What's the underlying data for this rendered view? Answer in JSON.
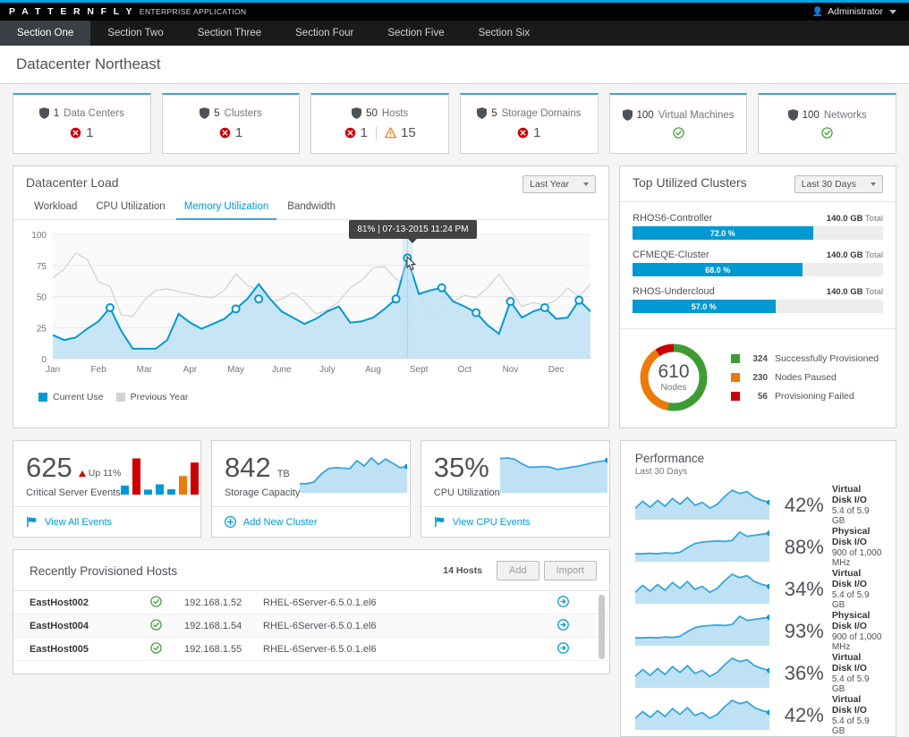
{
  "masthead": {
    "brand": "P A T T E R N F L Y",
    "brand_sub": "ENTERPRISE APPLICATION",
    "user": "Administrator",
    "user_icon": "user-icon",
    "caret_icon": "chevron-down-icon"
  },
  "nav": {
    "items": [
      {
        "label": "Section One",
        "active": true
      },
      {
        "label": "Section Two",
        "active": false
      },
      {
        "label": "Section Three",
        "active": false
      },
      {
        "label": "Section Four",
        "active": false
      },
      {
        "label": "Section Five",
        "active": false
      },
      {
        "label": "Section Six",
        "active": false
      }
    ]
  },
  "page": {
    "title": "Datacenter Northeast"
  },
  "aggregate_cards": [
    {
      "count": "1",
      "label": "Data Centers",
      "icon": "shield-icon",
      "stats": [
        {
          "icon": "error-circle-icon",
          "value": "1",
          "color": "#cc0000"
        }
      ]
    },
    {
      "count": "5",
      "label": "Clusters",
      "icon": "shield-icon",
      "stats": [
        {
          "icon": "error-circle-icon",
          "value": "1",
          "color": "#cc0000"
        }
      ]
    },
    {
      "count": "50",
      "label": "Hosts",
      "icon": "shield-icon",
      "stats": [
        {
          "icon": "error-circle-icon",
          "value": "1",
          "color": "#cc0000"
        },
        {
          "icon": "warning-triangle-icon",
          "value": "15",
          "color": "#ec7a08"
        }
      ]
    },
    {
      "count": "5",
      "label": "Storage Domains",
      "icon": "shield-icon",
      "stats": [
        {
          "icon": "error-circle-icon",
          "value": "1",
          "color": "#cc0000"
        }
      ]
    },
    {
      "count": "100",
      "label": "Virtual Machines",
      "icon": "shield-icon",
      "stats": [
        {
          "icon": "ok-circle-icon",
          "value": "",
          "color": "#3f9c35"
        }
      ]
    },
    {
      "count": "100",
      "label": "Networks",
      "icon": "shield-icon",
      "stats": [
        {
          "icon": "ok-circle-icon",
          "value": "",
          "color": "#3f9c35"
        }
      ]
    }
  ],
  "datacenter_load": {
    "title": "Datacenter Load",
    "range_selector": "Last Year",
    "tabs": [
      {
        "label": "Workload",
        "active": false
      },
      {
        "label": "CPU Utilization",
        "active": false
      },
      {
        "label": "Memory Utilization",
        "active": true
      },
      {
        "label": "Bandwidth",
        "active": false
      }
    ],
    "tooltip": "81% | 07-13-2015 11:24 PM",
    "legend": [
      {
        "label": "Current Use",
        "color": "#0099d3"
      },
      {
        "label": "Previous Year",
        "color": "#d1d1d1"
      }
    ]
  },
  "chart_data": {
    "type": "area",
    "title": "Datacenter Load — Memory Utilization",
    "xlabel": "",
    "ylabel": "",
    "ylim": [
      0,
      100
    ],
    "yticks": [
      0,
      25,
      50,
      75,
      100
    ],
    "grid": true,
    "legend_position": "bottom-left",
    "tick_labels": [
      "Jan",
      "Feb",
      "Mar",
      "Apr",
      "May",
      "June",
      "July",
      "Aug",
      "Sept",
      "Oct",
      "Nov",
      "Dec"
    ],
    "x": [
      0,
      1,
      2,
      3,
      4,
      5,
      6,
      7,
      8,
      9,
      10,
      11,
      12,
      13,
      14,
      15,
      16,
      17,
      18,
      19,
      20,
      21,
      22,
      23,
      24,
      25,
      26,
      27,
      28,
      29,
      30,
      31,
      32,
      33,
      34,
      35,
      36,
      37,
      38,
      39,
      40,
      41,
      42,
      43,
      44,
      45,
      46,
      47
    ],
    "series": [
      {
        "name": "Current Use",
        "color": "#0099d3",
        "values": [
          19,
          15,
          17,
          24,
          30,
          41,
          22,
          8,
          8,
          8,
          15,
          36,
          29,
          24,
          28,
          32,
          40,
          48,
          60,
          48,
          38,
          33,
          28,
          32,
          38,
          42,
          29,
          30,
          33,
          40,
          48,
          81,
          52,
          55,
          57,
          46,
          42,
          37,
          27,
          20,
          46,
          33,
          38,
          41,
          32,
          33,
          47,
          38
        ],
        "markers": [
          {
            "x": 5,
            "y": 41
          },
          {
            "x": 16,
            "y": 40
          },
          {
            "x": 18,
            "y": 48
          },
          {
            "x": 30,
            "y": 48
          },
          {
            "x": 31,
            "y": 81
          },
          {
            "x": 34,
            "y": 57
          },
          {
            "x": 37,
            "y": 37
          },
          {
            "x": 40,
            "y": 46
          },
          {
            "x": 43,
            "y": 41
          },
          {
            "x": 46,
            "y": 47
          }
        ]
      },
      {
        "name": "Previous Year",
        "color": "#d1d1d1",
        "values": [
          65,
          72,
          85,
          80,
          62,
          58,
          35,
          34,
          47,
          55,
          56,
          54,
          52,
          50,
          49,
          55,
          68,
          59,
          55,
          46,
          48,
          53,
          46,
          36,
          39,
          46,
          57,
          63,
          73,
          74,
          64,
          59,
          53,
          35,
          36,
          46,
          51,
          49,
          57,
          68,
          55,
          42,
          45,
          43,
          47,
          57,
          50,
          60
        ]
      }
    ]
  },
  "top_clusters": {
    "title": "Top Utilized Clusters",
    "range_selector": "Last 30 Days",
    "items": [
      {
        "name": "RHOS6-Controller",
        "percent": 72.0,
        "percent_label": "72.0 %",
        "total": "140.0 GB",
        "total_suffix": "Total"
      },
      {
        "name": "CFMEQE-Cluster",
        "percent": 68.0,
        "percent_label": "68.0 %",
        "total": "140.0 GB",
        "total_suffix": "Total"
      },
      {
        "name": "RHOS-Undercloud",
        "percent": 57.0,
        "percent_label": "57.0 %",
        "total": "140.0 GB",
        "total_suffix": "Total"
      }
    ]
  },
  "nodes_donut": {
    "type": "pie",
    "center_value": "610",
    "center_label": "Nodes",
    "slices": [
      {
        "label": "Successfully Provisioned",
        "value": 324,
        "value_label": "324",
        "color": "#3f9c35"
      },
      {
        "label": "Nodes Paused",
        "value": 230,
        "value_label": "230",
        "color": "#ec7a08"
      },
      {
        "label": "Provisioning Failed",
        "value": 56,
        "value_label": "56",
        "color": "#cc0000"
      }
    ]
  },
  "mini_cards": [
    {
      "value": "625",
      "unit": "",
      "trend": "Up 11%",
      "trend_icon": "arrow-up-icon",
      "label": "Critical Server Events",
      "footer": "View All Events",
      "footer_icon": "flag-icon",
      "graph": "bar",
      "bars": [
        {
          "height": 22,
          "color": "#0099d3"
        },
        {
          "height": 88,
          "color": "#cc0000"
        },
        {
          "height": 12,
          "color": "#0099d3"
        },
        {
          "height": 25,
          "color": "#0099d3"
        },
        {
          "height": 13,
          "color": "#0099d3"
        },
        {
          "height": 45,
          "color": "#ec7a08"
        },
        {
          "height": 78,
          "color": "#cc0000"
        }
      ]
    },
    {
      "value": "842",
      "unit": "TB",
      "trend": "",
      "trend_icon": "",
      "label": "Storage Capacity",
      "footer": "Add New Cluster",
      "footer_icon": "plus-circle-icon",
      "graph": "area",
      "points": [
        12,
        12,
        15,
        30,
        40,
        42,
        41,
        40,
        55,
        45,
        60,
        48,
        58,
        50,
        42,
        44
      ]
    },
    {
      "value": "35%",
      "unit": "",
      "trend": "",
      "trend_icon": "",
      "label": "CPU Utilization",
      "footer": "View CPU Events",
      "footer_icon": "flag-icon",
      "graph": "area",
      "points": [
        55,
        56,
        54,
        46,
        40,
        40,
        41,
        40,
        36,
        38,
        40,
        42,
        45,
        48,
        50,
        52
      ]
    }
  ],
  "hosts": {
    "title": "Recently Provisioned Hosts",
    "count_label": "14 Hosts",
    "buttons": [
      {
        "label": "Add"
      },
      {
        "label": "Import"
      }
    ],
    "rows": [
      {
        "name": "EastHost002",
        "status_icon": "ok-circle-icon",
        "ip": "192.168.1.52",
        "os": "RHEL-6Server-6.5.0.1.el6",
        "action_icon": "arrow-circle-right-icon"
      },
      {
        "name": "EastHost004",
        "status_icon": "ok-circle-icon",
        "ip": "192.168.1.54",
        "os": "RHEL-6Server-6.5.0.1.el6",
        "action_icon": "arrow-circle-right-icon"
      },
      {
        "name": "EastHost005",
        "status_icon": "ok-circle-icon",
        "ip": "192.168.1.55",
        "os": "RHEL-6Server-6.5.0.1.el6",
        "action_icon": "arrow-circle-right-icon"
      }
    ]
  },
  "performance": {
    "title": "Performance",
    "subtitle": "Last 30 Days",
    "rows": [
      {
        "percent": "42%",
        "name": "Virtual Disk I/O",
        "detail": "5.4 of 5.9 GB",
        "spark": "spiky"
      },
      {
        "percent": "88%",
        "name": "Physical Disk I/O",
        "detail": "900 of 1,000 MHz",
        "spark": "rising"
      },
      {
        "percent": "34%",
        "name": "Virtual Disk I/O",
        "detail": "5.4 of 5.9 GB",
        "spark": "spiky"
      },
      {
        "percent": "93%",
        "name": "Physical Disk I/O",
        "detail": "900 of 1,000 MHz",
        "spark": "rising"
      },
      {
        "percent": "36%",
        "name": "Virtual Disk I/O",
        "detail": "5.4 of 5.9 GB",
        "spark": "spiky"
      },
      {
        "percent": "42%",
        "name": "Virtual Disk I/O",
        "detail": "5.4 of 5.9 GB",
        "spark": "spiky"
      }
    ]
  },
  "colors": {
    "accent": "#0099d3",
    "accent_dark": "#39a5dc",
    "danger": "#cc0000",
    "warning": "#ec7a08",
    "success": "#3f9c35",
    "area_fill": "#bee1f4"
  }
}
